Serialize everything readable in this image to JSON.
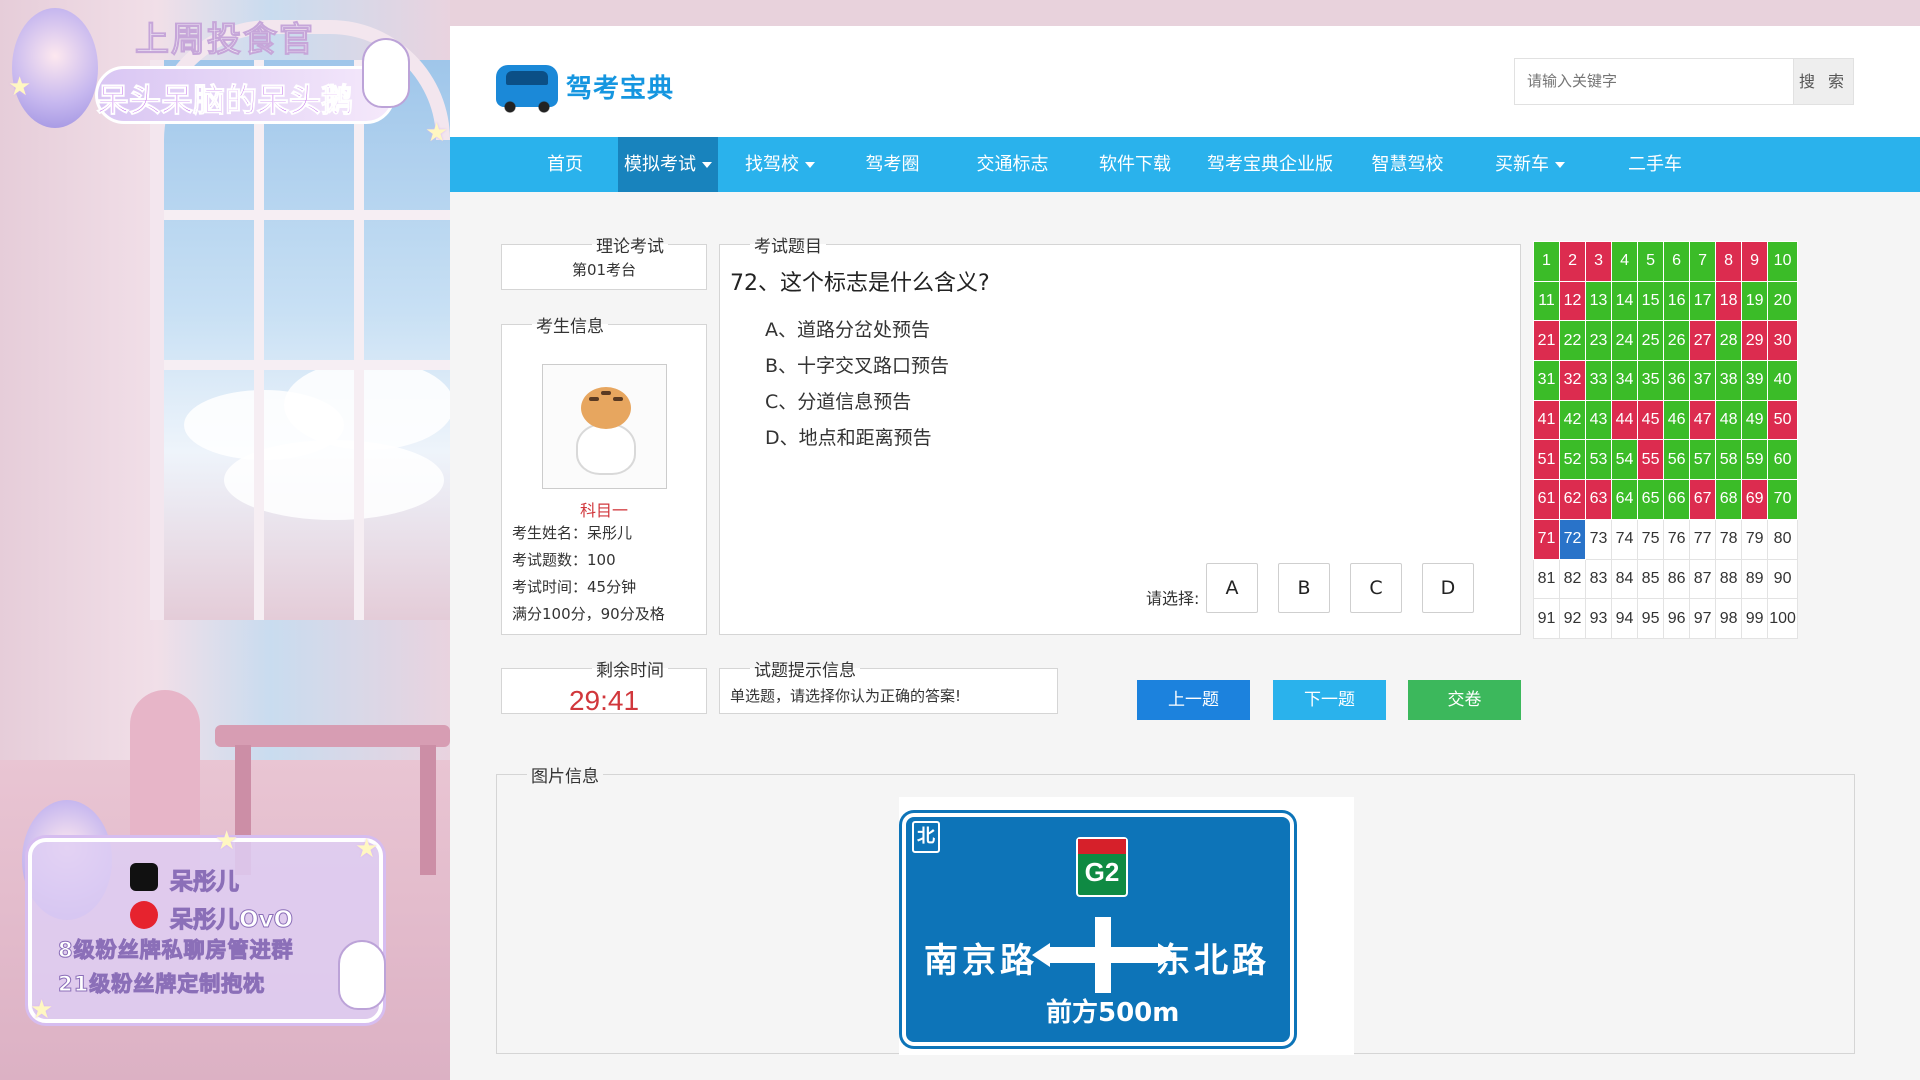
{
  "overlay": {
    "top_title": "上周投食官",
    "top_name": "呆头呆脑的呆头鹅",
    "douyin_name": "呆彤儿",
    "weibo_name": "呆彤儿OvO",
    "fan_line_1": "8级粉丝牌私聊房管进群",
    "fan_line_2": "21级粉丝牌定制抱枕"
  },
  "header": {
    "logo_text": "驾考宝典",
    "search_placeholder": "请输入关键字",
    "search_button": "搜 索"
  },
  "nav": {
    "items": [
      {
        "label": "首页"
      },
      {
        "label": "模拟考试"
      },
      {
        "label": "找驾校"
      },
      {
        "label": "驾考圈"
      },
      {
        "label": "交通标志"
      },
      {
        "label": "软件下载"
      },
      {
        "label": "驾考宝典企业版"
      },
      {
        "label": "智慧驾校"
      },
      {
        "label": "买新车"
      },
      {
        "label": "二手车"
      }
    ],
    "active_index": 1
  },
  "theory": {
    "legend": "理论考试",
    "seat": "第01考台"
  },
  "student": {
    "legend": "考生信息",
    "subject": "科目一",
    "name_line": "考生姓名：呆彤儿",
    "count_line": "考试题数：100",
    "time_line": "考试时间：45分钟",
    "score_line": "满分100分，90分及格"
  },
  "question": {
    "legend": "考试题目",
    "text": "72、这个标志是什么含义?",
    "options": [
      "A、道路分岔处预告",
      "B、十字交叉路口预告",
      "C、分道信息预告",
      "D、地点和距离预告"
    ],
    "choose_label": "请选择:",
    "answer_buttons": [
      "A",
      "B",
      "C",
      "D"
    ]
  },
  "grid": {
    "numbers": [
      1,
      2,
      3,
      4,
      5,
      6,
      7,
      8,
      9,
      10,
      11,
      12,
      13,
      14,
      15,
      16,
      17,
      18,
      19,
      20,
      21,
      22,
      23,
      24,
      25,
      26,
      27,
      28,
      29,
      30,
      31,
      32,
      33,
      34,
      35,
      36,
      37,
      38,
      39,
      40,
      41,
      42,
      43,
      44,
      45,
      46,
      47,
      48,
      49,
      50,
      51,
      52,
      53,
      54,
      55,
      56,
      57,
      58,
      59,
      60,
      61,
      62,
      63,
      64,
      65,
      66,
      67,
      68,
      69,
      70,
      71,
      72,
      73,
      74,
      75,
      76,
      77,
      78,
      79,
      80,
      81,
      82,
      83,
      84,
      85,
      86,
      87,
      88,
      89,
      90,
      91,
      92,
      93,
      94,
      95,
      96,
      97,
      98,
      99,
      100
    ],
    "status": [
      "g",
      "r",
      "r",
      "g",
      "g",
      "g",
      "g",
      "r",
      "r",
      "g",
      "g",
      "r",
      "g",
      "g",
      "g",
      "g",
      "g",
      "r",
      "g",
      "g",
      "r",
      "g",
      "g",
      "g",
      "g",
      "g",
      "r",
      "g",
      "r",
      "r",
      "g",
      "r",
      "g",
      "g",
      "g",
      "g",
      "g",
      "g",
      "g",
      "g",
      "r",
      "g",
      "g",
      "r",
      "r",
      "g",
      "r",
      "g",
      "g",
      "r",
      "r",
      "g",
      "g",
      "g",
      "r",
      "g",
      "g",
      "g",
      "g",
      "g",
      "r",
      "r",
      "r",
      "g",
      "g",
      "g",
      "r",
      "g",
      "r",
      "g",
      "r",
      "b",
      "n",
      "n",
      "n",
      "n",
      "n",
      "n",
      "n",
      "n",
      "n",
      "n",
      "n",
      "n",
      "n",
      "n",
      "n",
      "n",
      "n",
      "n",
      "n",
      "n",
      "n",
      "n",
      "n",
      "n",
      "n",
      "n",
      "n",
      "n"
    ],
    "colors": {
      "g": "#3bbc28",
      "r": "#dc2c4f",
      "b": "#2973c9"
    }
  },
  "timer": {
    "legend": "剩余时间",
    "value": "29:41"
  },
  "hint": {
    "legend": "试题提示信息",
    "text": "单选题，请选择你认为正确的答案!"
  },
  "actions": {
    "prev": "上一题",
    "next": "下一题",
    "submit": "交卷"
  },
  "image_info": {
    "legend": "图片信息",
    "sign_north": "北",
    "sign_route": "G2",
    "sign_left_road": "南京路",
    "sign_right_road": "东北路",
    "sign_distance": "前方500m"
  }
}
